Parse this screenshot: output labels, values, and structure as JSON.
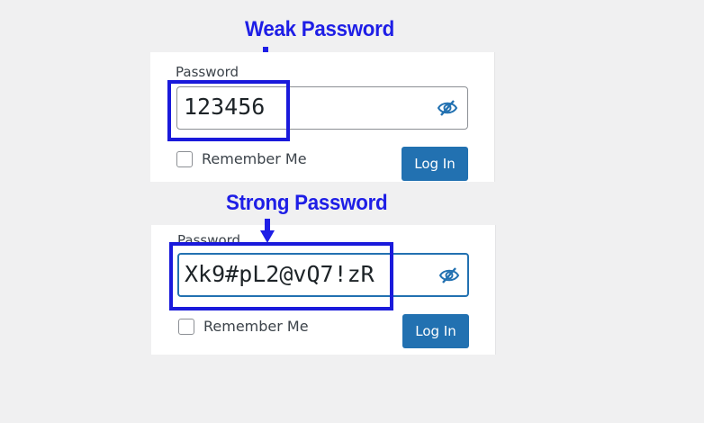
{
  "annotations": {
    "weak_caption": "Weak Password",
    "strong_caption": "Strong Password",
    "annotation_color": "#1e1ee6"
  },
  "weak_form": {
    "password_label": "Password",
    "password_value": "123456",
    "visibility_icon": "eye-slash-icon",
    "remember_label": "Remember Me",
    "remember_checked": false,
    "login_label": "Log In"
  },
  "strong_form": {
    "password_label": "Password",
    "password_value": "Xk9#pL2@vQ7!zR",
    "visibility_icon": "eye-slash-icon",
    "remember_label": "Remember Me",
    "remember_checked": false,
    "login_label": "Log In"
  },
  "colors": {
    "accent": "#2271b1",
    "background": "#f0f0f1"
  }
}
